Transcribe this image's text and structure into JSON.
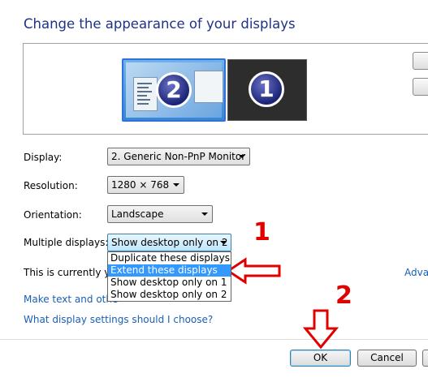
{
  "window": {
    "title": "Change the appearance of your displays"
  },
  "preview": {
    "monitors": [
      {
        "number": "2",
        "selected": true
      },
      {
        "number": "1",
        "selected": false
      }
    ]
  },
  "form": {
    "display": {
      "label": "Display:",
      "value": "2. Generic Non-PnP Monitor"
    },
    "resolution": {
      "label": "Resolution:",
      "value": "1280 × 768"
    },
    "orientation": {
      "label": "Orientation:",
      "value": "Landscape"
    },
    "multiple_displays": {
      "label": "Multiple displays:",
      "value": "Show desktop only on 2",
      "options": [
        "Duplicate these displays",
        "Extend these displays",
        "Show desktop only on 1",
        "Show desktop only on 2"
      ],
      "highlighted_option": "Extend these displays"
    }
  },
  "status_text": "This is currently you",
  "links": {
    "advanced": "Adva",
    "make_text": "Make text and othe",
    "which_settings": "What display settings should I choose?"
  },
  "buttons": {
    "ok": "OK",
    "cancel": "Cancel"
  },
  "annotations": {
    "step1": "1",
    "step2": "2"
  },
  "colors": {
    "title": "#1e3287",
    "link": "#1a5fb4",
    "highlight": "#3399ff",
    "annotation": "#e00000"
  }
}
